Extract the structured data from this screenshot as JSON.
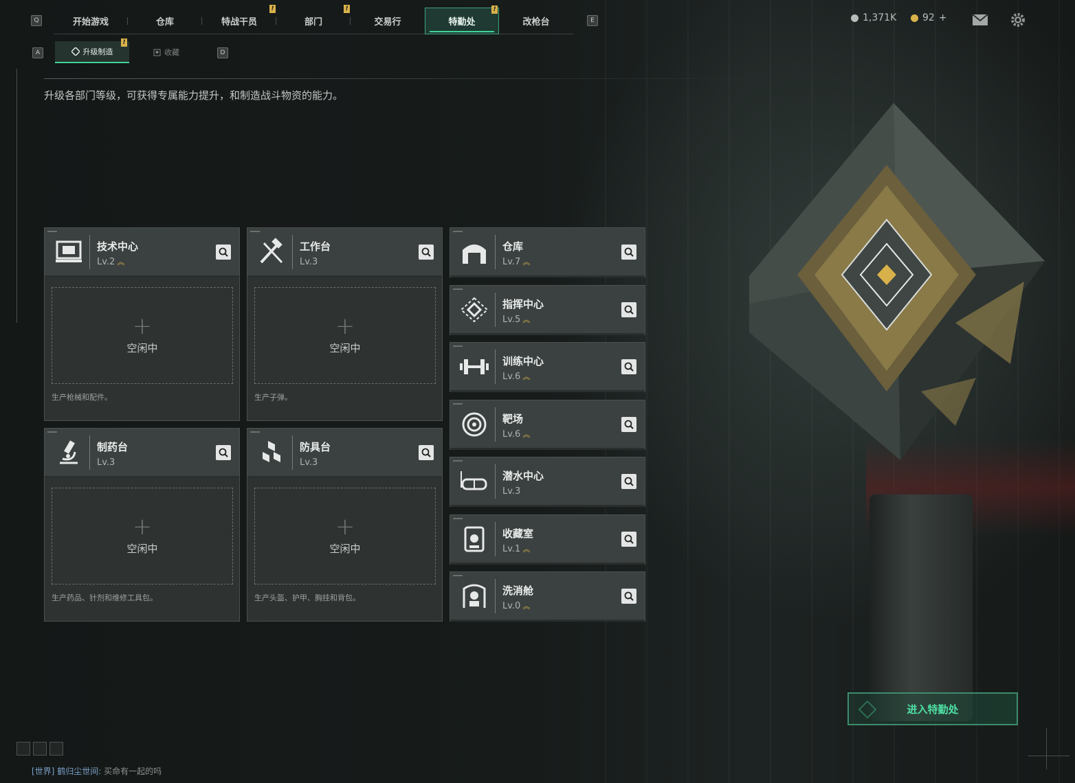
{
  "top_tabs": [
    {
      "label": "开始游戏",
      "badge": ""
    },
    {
      "label": "仓库",
      "badge": ""
    },
    {
      "label": "特战干员",
      "badge": "!"
    },
    {
      "label": "部门",
      "badge": "!"
    },
    {
      "label": "交易行",
      "badge": ""
    },
    {
      "label": "特勤处",
      "badge": "!",
      "active": true
    },
    {
      "label": "改枪台",
      "badge": ""
    }
  ],
  "keys": {
    "left": "Q",
    "right": "E",
    "sub_left": "A",
    "sub_right": "D"
  },
  "currency": {
    "silver": "1,371K",
    "gold": "92",
    "gold_plus": "+"
  },
  "sub_tabs": [
    {
      "label": "升级制造",
      "active": true,
      "badge": "!"
    },
    {
      "label": "收藏",
      "active": false
    }
  ],
  "description": "升级各部门等级，可获得专属能力提升，和制造战斗物资的能力。",
  "craft_cards": [
    {
      "name": "技术中心",
      "level": "Lv.2",
      "upgradable": true,
      "slot": "空闲中",
      "note": "生产枪械和配件。",
      "icon": "computer-icon"
    },
    {
      "name": "工作台",
      "level": "Lv.3",
      "upgradable": false,
      "slot": "空闲中",
      "note": "生产子弹。",
      "icon": "tools-icon"
    },
    {
      "name": "制药台",
      "level": "Lv.3",
      "upgradable": false,
      "slot": "空闲中",
      "note": "生产药品、针剂和维修工具包。",
      "icon": "microscope-icon"
    },
    {
      "name": "防具台",
      "level": "Lv.3",
      "upgradable": false,
      "slot": "空闲中",
      "note": "生产头盔、护甲、胸挂和背包。",
      "icon": "cubes-icon"
    }
  ],
  "facilities": [
    {
      "name": "仓库",
      "level": "Lv.7",
      "upgradable": true,
      "icon": "warehouse-icon"
    },
    {
      "name": "指挥中心",
      "level": "Lv.5",
      "upgradable": true,
      "icon": "command-icon"
    },
    {
      "name": "训练中心",
      "level": "Lv.6",
      "upgradable": true,
      "icon": "dumbbell-icon"
    },
    {
      "name": "靶场",
      "level": "Lv.6",
      "upgradable": true,
      "icon": "target-icon"
    },
    {
      "name": "潜水中心",
      "level": "Lv.3",
      "upgradable": false,
      "icon": "goggles-icon"
    },
    {
      "name": "收藏室",
      "level": "Lv.1",
      "upgradable": true,
      "icon": "display-case-icon"
    },
    {
      "name": "洗消舱",
      "level": "Lv.0",
      "upgradable": true,
      "icon": "decon-icon"
    }
  ],
  "enter_button": "进入特勤处",
  "chat": {
    "channel": "[世界]",
    "user": "鹤归尘世间:",
    "message": "买命有一起的吗"
  },
  "colors": {
    "accent": "#3fd39a",
    "badge": "#d8b14a"
  }
}
